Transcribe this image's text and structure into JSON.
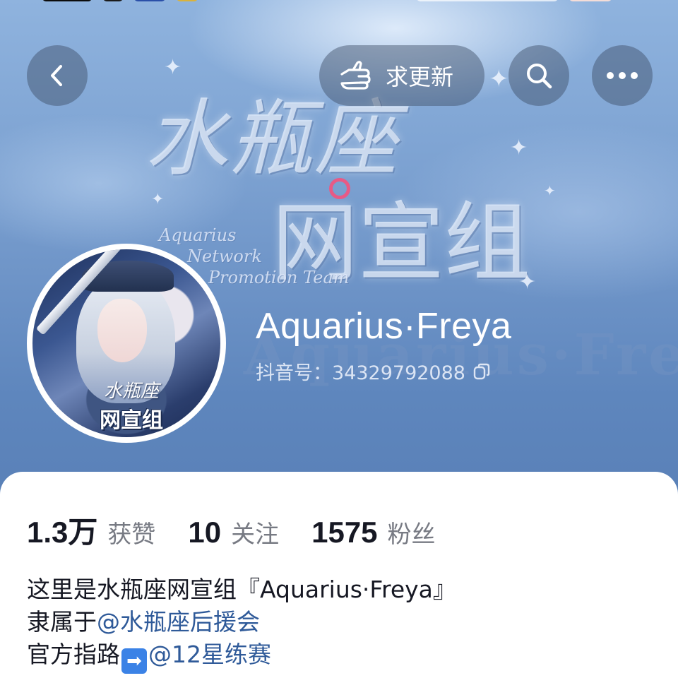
{
  "banner": {
    "art_title": "水瓶座",
    "art_subtitle": "网宣组",
    "art_english": [
      "Aquarius",
      "Network",
      "Promotion Team"
    ],
    "watermark": "Aquarius·Freya"
  },
  "nav": {
    "update_label": "求更新"
  },
  "profile": {
    "name": "Aquarius·Freya",
    "douyin_id": "抖音号：34329792088",
    "avatar_badge_line1": "水瓶座",
    "avatar_badge_line2": "网宣组"
  },
  "stats": [
    {
      "value": "1.3万",
      "label": "获赞"
    },
    {
      "value": "10",
      "label": "关注"
    },
    {
      "value": "1575",
      "label": "粉丝"
    }
  ],
  "bio": {
    "line1": "这里是水瓶座网宣组『Aquarius·Freya』",
    "line2_prefix": "隶属于",
    "line2_mention": "@水瓶座后援会",
    "line3_prefix": "官方指路",
    "line3_arrow": "➡",
    "line3_mention": "@12星练赛"
  },
  "colors": {
    "mention": "#2f5a99",
    "banner_blue": "#7fa4d3",
    "accent_ring": "#e85a86"
  },
  "icons": [
    "back-arrow-icon",
    "hand-point-icon",
    "search-icon",
    "more-icon",
    "copy-icon"
  ]
}
